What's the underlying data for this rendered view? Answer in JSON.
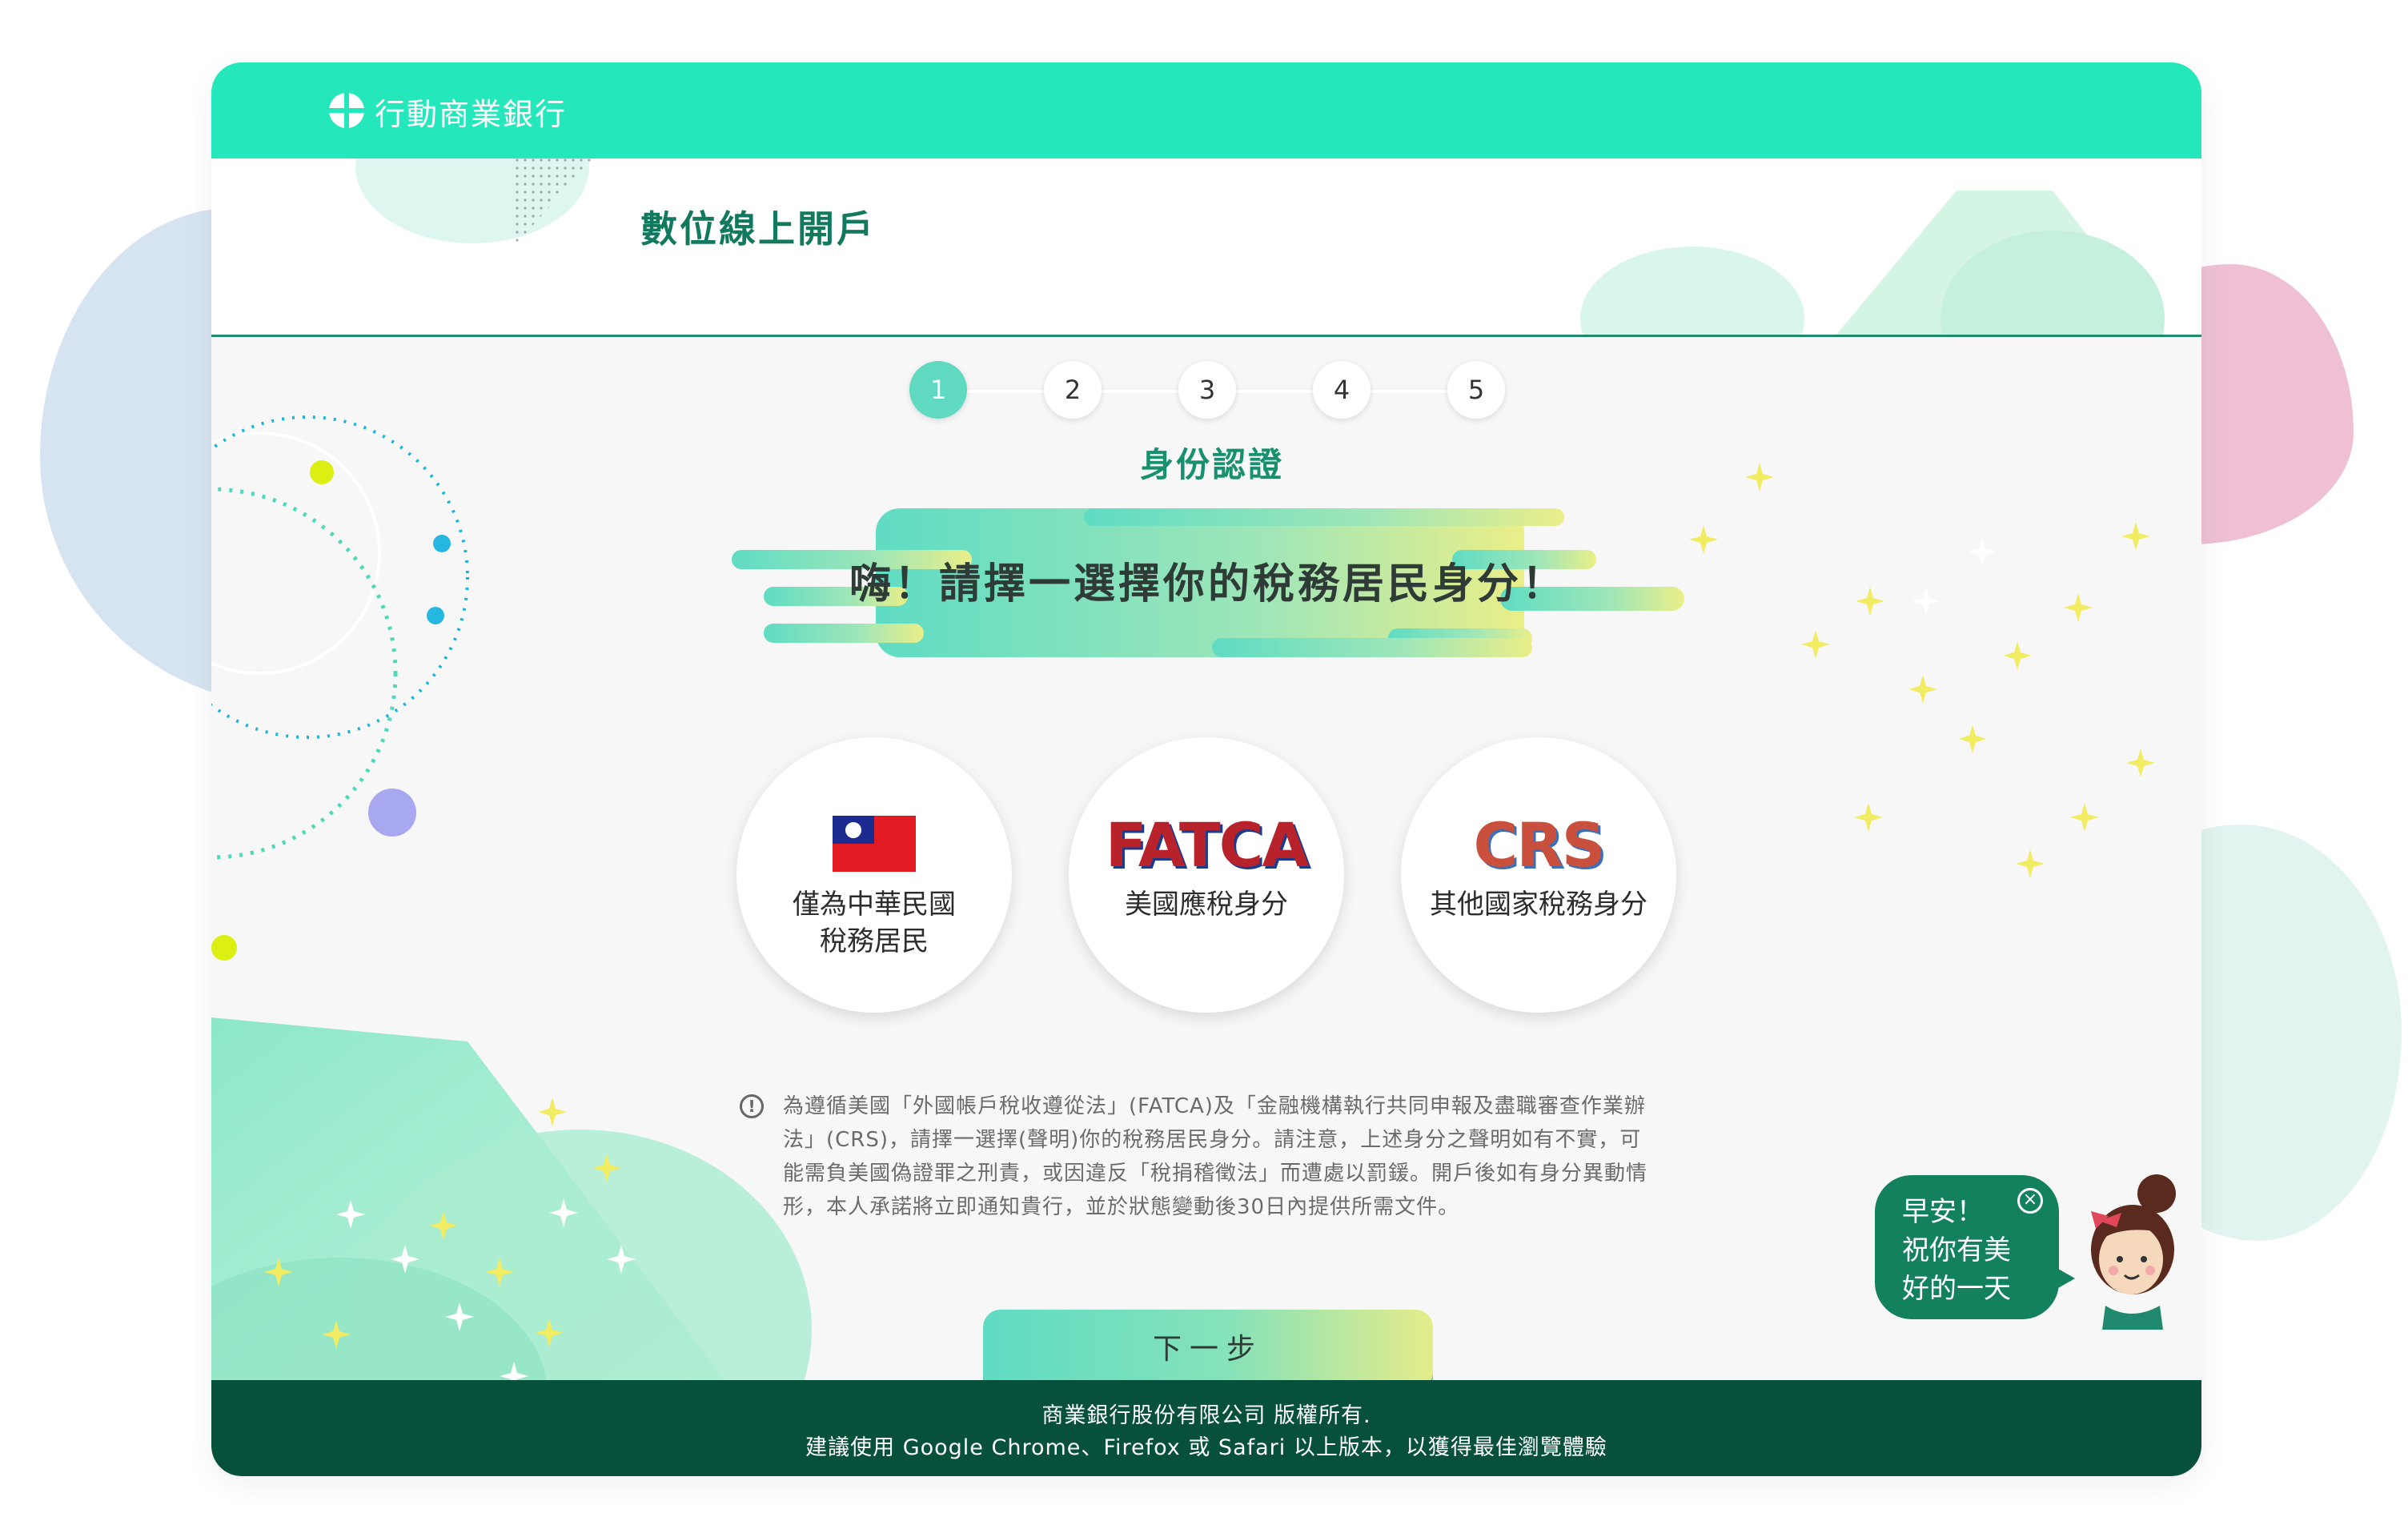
{
  "app": {
    "name": "行動商業銀行"
  },
  "header": {
    "title": "數位線上開戶"
  },
  "stepper": {
    "steps": [
      "1",
      "2",
      "3",
      "4",
      "5"
    ],
    "active_step": 1,
    "current_label": "身份認證"
  },
  "banner": {
    "text": "嗨！請擇一選擇你的稅務居民身分！"
  },
  "options": [
    {
      "label_line1": "僅為中華民國",
      "label_line2": "稅務居民",
      "icon": "taiwan-flag-icon"
    },
    {
      "label": "美國應稅身分",
      "logo_text": "FATCA",
      "icon": "fatca-logo-icon"
    },
    {
      "label": "其他國家稅務身分",
      "logo_text": "CRS",
      "icon": "crs-logo-icon"
    }
  ],
  "notice": {
    "icon": "info-icon",
    "text": "為遵循美國「外國帳戶稅收遵從法」(FATCA)及「金融機構執行共同申報及盡職審查作業辦法」(CRS)，請擇一選擇(聲明)你的稅務居民身分。請注意，上述身分之聲明如有不實，可能需負美國偽證罪之刑責，或因違反「稅捐稽徵法」而遭處以罰鍰。開戶後如有身分異動情形，本人承諾將立即通知貴行，並於狀態變動後30日內提供所需文件。"
  },
  "actions": {
    "next_label": "下一步"
  },
  "greeting": {
    "line1": "早安！",
    "line2": "祝你有美",
    "line3": "好的一天"
  },
  "footer": {
    "copyright": "商業銀行股份有限公司 版權所有.",
    "browser_note": "建議使用 Google Chrome、Firefox 或 Safari 以上版本，以獲得最佳瀏覽體驗"
  },
  "colors": {
    "brand_mint": "#24e8bb",
    "brand_dark_green": "#07513c",
    "title_green": "#117a5e",
    "active_step": "#5fd9bf"
  }
}
